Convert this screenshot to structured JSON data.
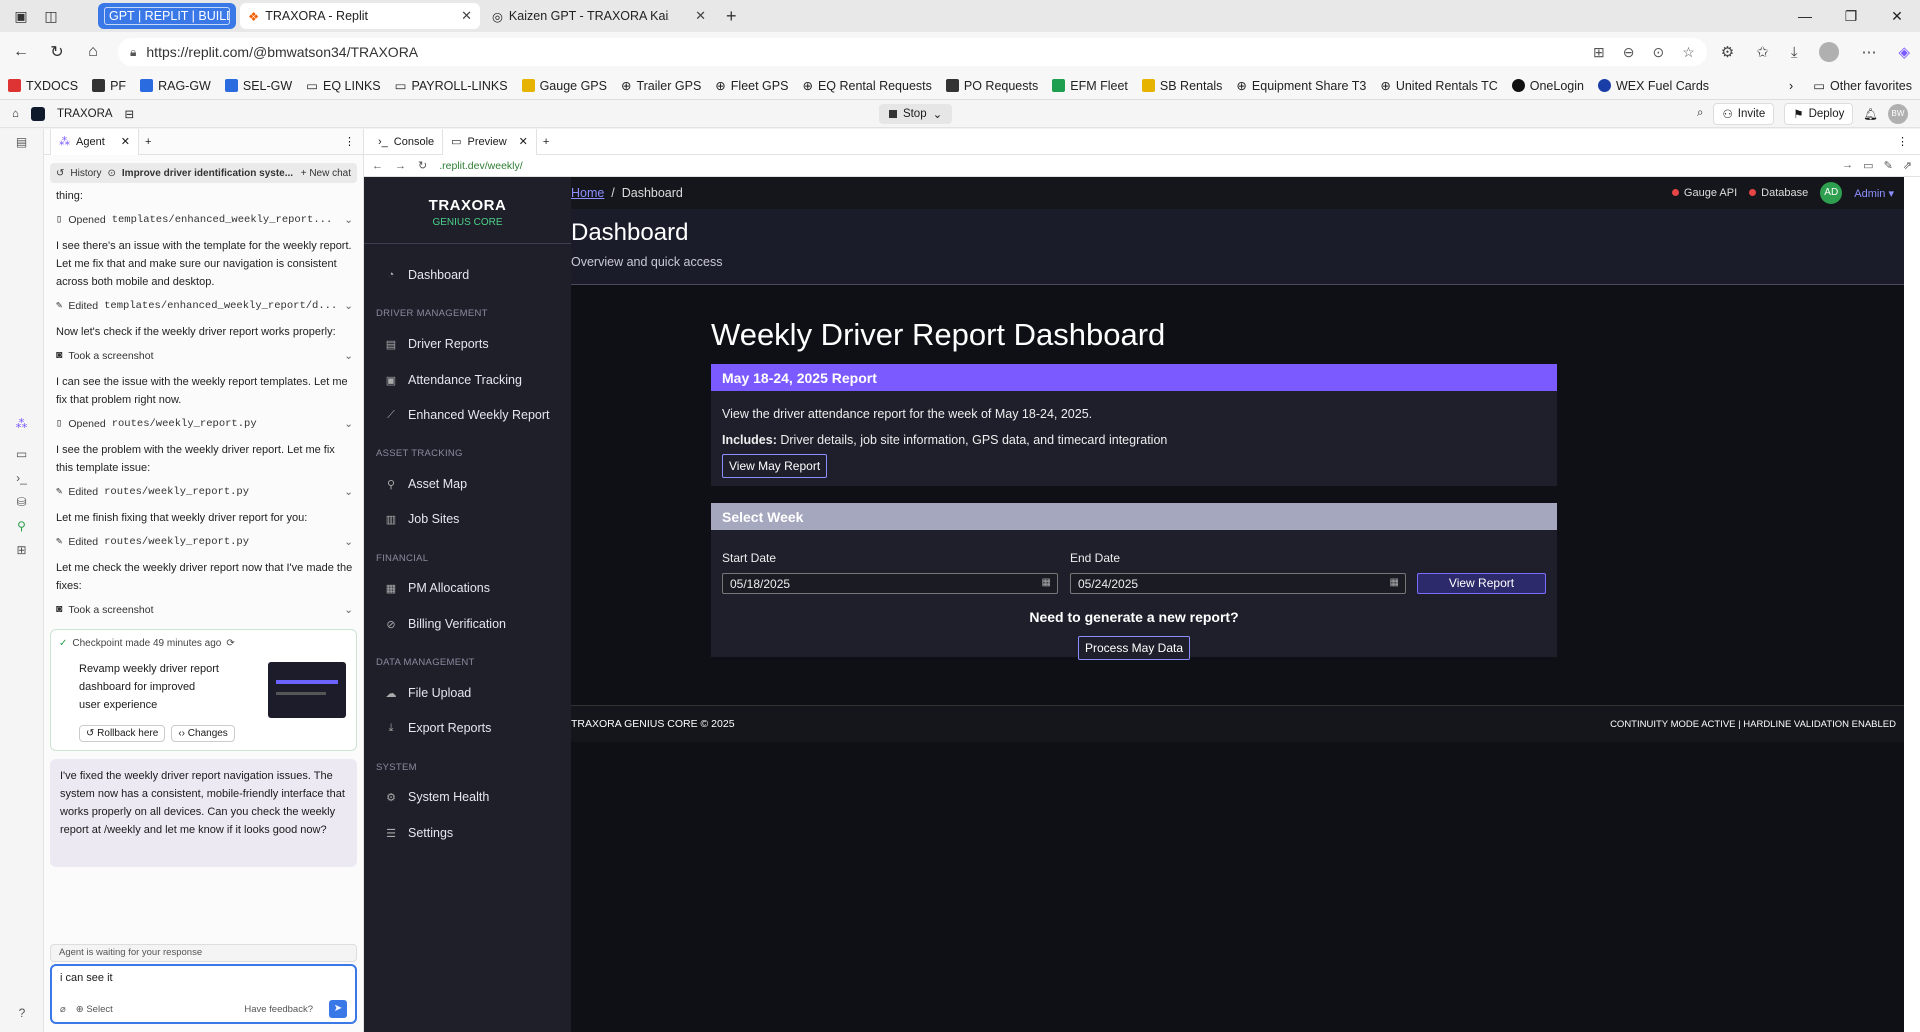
{
  "browser": {
    "tabs": [
      {
        "label": "GPT | REPLIT | BUILDIN"
      },
      {
        "label": "TRAXORA - Replit"
      },
      {
        "label": "Kaizen GPT - TRAXORA Kaizen Int"
      }
    ],
    "url": "https://replit.com/@bmwatson34/TRAXORA",
    "favorites": [
      "TXDOCS",
      "PF",
      "RAG-GW",
      "SEL-GW",
      "EQ LINKS",
      "PAYROLL-LINKS",
      "Gauge GPS",
      "Trailer GPS",
      "Fleet GPS",
      "EQ Rental Requests",
      "PO Requests",
      "EFM Fleet",
      "SB Rentals",
      "Equipment Share T3",
      "United Rentals TC",
      "OneLogin",
      "WEX Fuel Cards"
    ],
    "other_favorites": "Other favorites"
  },
  "replit": {
    "project": "TRAXORA",
    "stop_label": "Stop",
    "invite_label": "Invite",
    "deploy_label": "Deploy",
    "user_initials": "BW"
  },
  "agent": {
    "tab_label": "Agent",
    "history_label": "History",
    "history_title": "Improve driver identification syste...",
    "new_chat": "New chat",
    "messages": [
      {
        "text": "thing:"
      },
      {
        "action_label": "Opened",
        "action_target": "templates/enhanced_weekly_report..."
      },
      {
        "text": "I see there's an issue with the template for the weekly report. Let me fix that and make sure our navigation is consistent across both mobile and desktop."
      },
      {
        "action_label": "Edited",
        "action_target": "templates/enhanced_weekly_report/d..."
      },
      {
        "text": "Now let's check if the weekly driver report works properly:"
      },
      {
        "action_label": "Took a screenshot",
        "action_target": ""
      },
      {
        "text": "I can see the issue with the weekly report templates. Let me fix that problem right now."
      },
      {
        "action_label": "Opened",
        "action_target": "routes/weekly_report.py"
      },
      {
        "text": "I see the problem with the weekly driver report. Let me fix this template issue:"
      },
      {
        "action_label": "Edited",
        "action_target": "routes/weekly_report.py"
      },
      {
        "text": "Let me finish fixing that weekly driver report for you:"
      },
      {
        "action_label": "Edited",
        "action_target": "routes/weekly_report.py"
      },
      {
        "text": "Let me check the weekly driver report now that I've made the fixes:"
      },
      {
        "action_label": "Took a screenshot",
        "action_target": ""
      }
    ],
    "checkpoint": {
      "title": "Checkpoint made 49 minutes ago",
      "text": "Revamp weekly driver report dashboard for improved user experience",
      "rollback": "Rollback here",
      "changes": "Changes"
    },
    "reply": "I've fixed the weekly driver report navigation issues. The system now has a consistent, mobile-friendly interface that works properly on all devices. Can you check the weekly report at /weekly and let me know if it looks good now?",
    "waiting": "Agent is waiting for your response",
    "input_value": "i can see it",
    "select_label": "Select",
    "feedback_label": "Have feedback?"
  },
  "preview": {
    "console_tab": "Console",
    "preview_tab": "Preview",
    "url": ".replit.dev/weekly/"
  },
  "app": {
    "brand": "TRAXORA",
    "brand_sub": "GENIUS CORE",
    "nav": {
      "dashboard": "Dashboard",
      "sec_driver": "DRIVER MANAGEMENT",
      "driver_reports": "Driver Reports",
      "attendance": "Attendance Tracking",
      "enhanced": "Enhanced Weekly Report",
      "sec_asset": "ASSET TRACKING",
      "asset_map": "Asset Map",
      "job_sites": "Job Sites",
      "sec_financial": "FINANCIAL",
      "pm_alloc": "PM Allocations",
      "billing": "Billing Verification",
      "sec_data": "DATA MANAGEMENT",
      "file_upload": "File Upload",
      "export": "Export Reports",
      "sec_system": "SYSTEM",
      "system_health": "System Health",
      "settings": "Settings"
    },
    "breadcrumb_home": "Home",
    "breadcrumb_current": "Dashboard",
    "status": {
      "gauge": "Gauge API",
      "database": "Database",
      "avatar": "AD",
      "admin": "Admin"
    },
    "page_title": "Dashboard",
    "page_sub": "Overview and quick access",
    "main_heading": "Weekly Driver Report Dashboard",
    "report_card": {
      "header": "May 18-24, 2025 Report",
      "body": "View the driver attendance report for the week of May 18-24, 2025.",
      "includes_label": "Includes:",
      "includes_text": " Driver details, job site information, GPS data, and timecard integration",
      "button": "View May Report"
    },
    "week_card": {
      "header": "Select Week",
      "start_label": "Start Date",
      "start_value": "05/18/2025",
      "end_label": "End Date",
      "end_value": "05/24/2025",
      "view_btn": "View Report",
      "need": "Need to generate a new report?",
      "process_btn": "Process May Data"
    },
    "footer_left": "TRAXORA GENIUS CORE © 2025",
    "footer_right": "CONTINUITY MODE ACTIVE | HARDLINE VALIDATION ENABLED"
  }
}
